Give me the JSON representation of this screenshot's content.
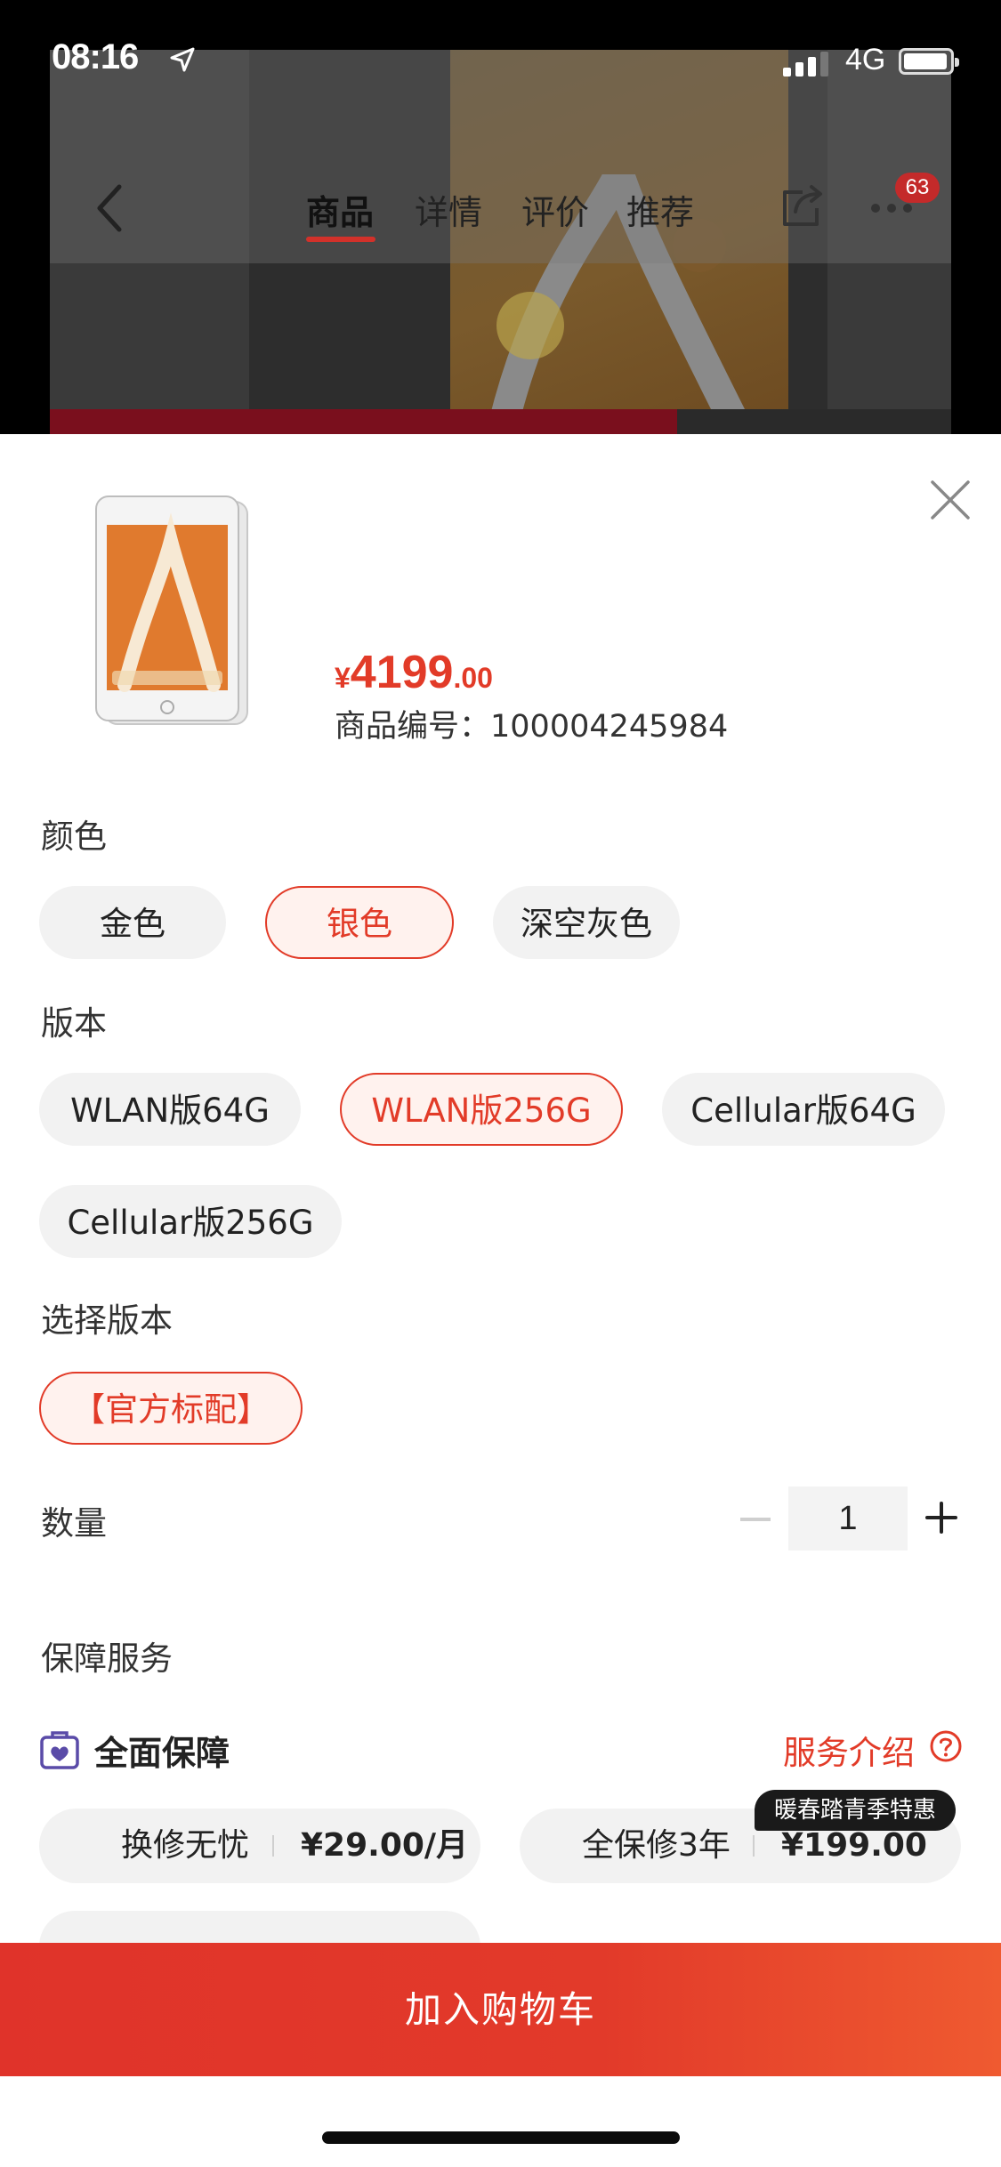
{
  "status_bar": {
    "time": "08:16",
    "network": "4G"
  },
  "nav": {
    "tabs": [
      {
        "label": "商品",
        "active": true
      },
      {
        "label": "详情",
        "active": false
      },
      {
        "label": "评价",
        "active": false
      },
      {
        "label": "推荐",
        "active": false
      }
    ],
    "badge_count": "63"
  },
  "product": {
    "price_symbol": "¥",
    "price_integer": "4199",
    "price_decimal": ".00",
    "sku_label": "商品编号：",
    "sku_number": "100004245984"
  },
  "color": {
    "label": "颜色",
    "options": [
      {
        "label": "金色",
        "selected": false
      },
      {
        "label": "银色",
        "selected": true
      },
      {
        "label": "深空灰色",
        "selected": false
      }
    ]
  },
  "version": {
    "label": "版本",
    "options": [
      {
        "label": "WLAN版64G",
        "selected": false
      },
      {
        "label": "WLAN版256G",
        "selected": true
      },
      {
        "label": "Cellular版64G",
        "selected": false
      },
      {
        "label": "Cellular版256G",
        "selected": false
      }
    ]
  },
  "package": {
    "label": "选择版本",
    "options": [
      {
        "label": "【官方标配】",
        "selected": true
      }
    ]
  },
  "quantity": {
    "label": "数量",
    "value": "1"
  },
  "guarantee": {
    "section_label": "保障服务",
    "title": "全面保障",
    "link_label": "服务介绍",
    "services": [
      {
        "name": "换修无忧",
        "price": "¥29.00/月"
      },
      {
        "name": "全保修3年",
        "price": "¥199.00",
        "promo": "暖春踏青季特惠"
      }
    ]
  },
  "cart_button": "加入购物车",
  "colors": {
    "accent": "#e23b28",
    "chip_bg": "#f2f2f2",
    "selected_bg": "#fff2ee"
  }
}
